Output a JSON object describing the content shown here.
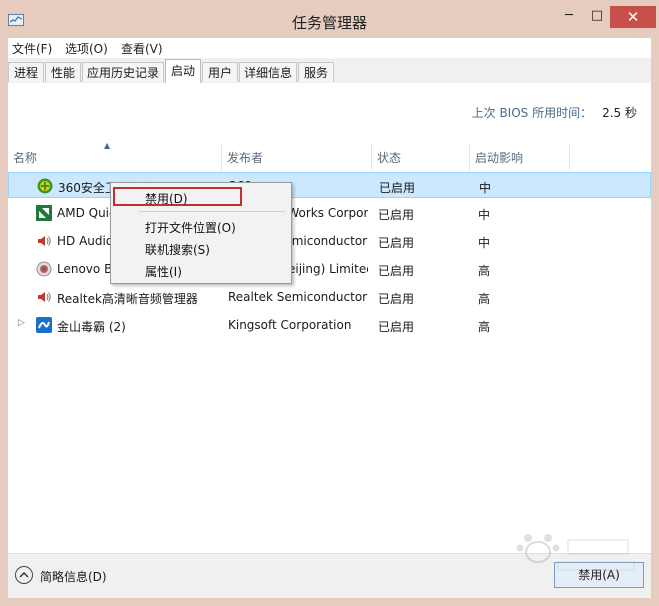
{
  "window": {
    "title": "任务管理器",
    "min_glyph": "─",
    "max_glyph": "□",
    "close_glyph": "✕"
  },
  "menu": [
    "文件(F)",
    "选项(O)",
    "查看(V)"
  ],
  "tabs": [
    "进程",
    "性能",
    "应用历史记录",
    "启动",
    "用户",
    "详细信息",
    "服务"
  ],
  "active_tab": "启动",
  "bios": {
    "label": "上次 BIOS 所用时间：",
    "value": "2.5 秒"
  },
  "columns": [
    "名称",
    "发布者",
    "状态",
    "启动影响"
  ],
  "rows": [
    {
      "icon": "360-safeguard-icon",
      "name": "360安全卫士安全防护中心",
      "publisher": "360",
      "status": "已启用",
      "impact": "中"
    },
    {
      "icon": "amd-quick-stream-icon",
      "name": "AMD Quick Stream",
      "publisher": "AMD PixelWorks Corporation",
      "status": "已启用",
      "impact": "中"
    },
    {
      "icon": "speaker-icon",
      "name": "HD Audio Background Process",
      "publisher": "Realtek Semiconductor",
      "status": "已启用",
      "impact": "中"
    },
    {
      "icon": "lenovo-icon",
      "name": "Lenovo Bluetooth Service",
      "publisher": "Lenovo (Beijing) Limited",
      "status": "已启用",
      "impact": "高"
    },
    {
      "icon": "speaker-icon",
      "name": "Realtek高清晰音频管理器",
      "publisher": "Realtek Semiconductor",
      "status": "已启用",
      "impact": "高"
    },
    {
      "icon": "kingsoft-antivirus-icon",
      "name": "金山毒霸 (2)",
      "publisher": "Kingsoft Corporation",
      "status": "已启用",
      "impact": "高"
    }
  ],
  "context_menu": [
    "禁用(D)",
    "打开文件位置(O)",
    "联机搜索(S)",
    "属性(I)"
  ],
  "footer": {
    "fewer_details": "简略信息(D)",
    "disable_button": "禁用(A)"
  },
  "colors": {
    "title_bg": "#e6ccbe",
    "close_bg": "#c7504a",
    "selected_row": "#cce8ff",
    "highlight_box": "#c0302e"
  }
}
